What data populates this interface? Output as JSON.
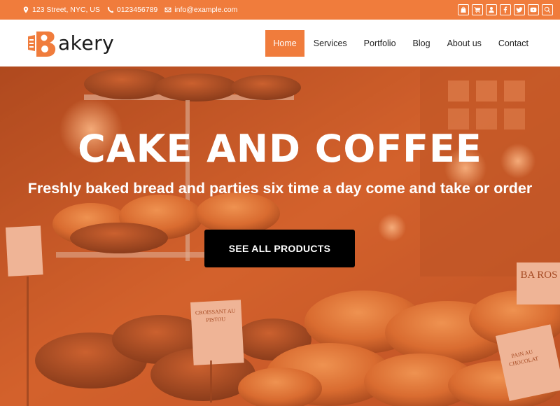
{
  "topbar": {
    "address": "123 Street, NYC, US",
    "phone": "0123456789",
    "email": "info@example.com",
    "social_icons": [
      "shopping-bag-icon",
      "cart-icon",
      "user-icon",
      "facebook-icon",
      "twitter-icon",
      "youtube-icon",
      "search-icon"
    ]
  },
  "header": {
    "logo_text": "akery",
    "nav": [
      {
        "label": "Home",
        "active": true
      },
      {
        "label": "Services",
        "active": false
      },
      {
        "label": "Portfolio",
        "active": false
      },
      {
        "label": "Blog",
        "active": false
      },
      {
        "label": "About us",
        "active": false
      },
      {
        "label": "Contact",
        "active": false
      }
    ]
  },
  "hero": {
    "title": "CAKE AND COFFEE",
    "subtitle": "Freshly baked bread and parties six time a day come and take or order",
    "cta_label": "SEE ALL PRODUCTS",
    "signs": [
      "CROISSANT AU PISTOU",
      "PAIN AU CHOCOLAT",
      "BA ROS"
    ]
  },
  "colors": {
    "accent": "#f07c3c",
    "button_bg": "#000000",
    "text_dark": "#222222"
  }
}
